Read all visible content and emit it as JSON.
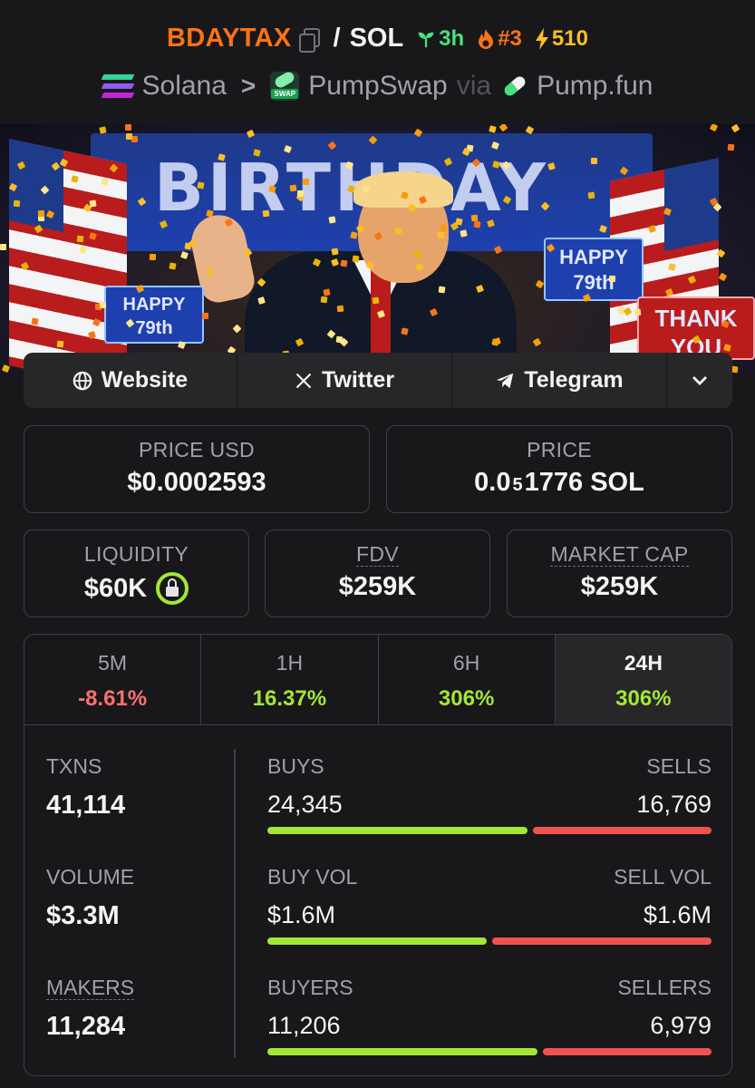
{
  "header": {
    "token_symbol": "BDAYTAX",
    "separator": "/",
    "quote_symbol": "SOL",
    "age": "3h",
    "rank": "#3",
    "boosts": "510",
    "chain": "Solana",
    "dex": "PumpSwap",
    "via": "via",
    "launchpad": "Pump.fun"
  },
  "links": {
    "website": "Website",
    "twitter": "Twitter",
    "telegram": "Telegram"
  },
  "banner": {
    "headline": "BIRTHDAY",
    "sign_left": "HAPPY 79th",
    "sign_right": "HAPPY 79th",
    "sign_thanks": "THANK YOU"
  },
  "price": {
    "usd_label": "PRICE USD",
    "usd_value": "$0.0002593",
    "native_label": "PRICE",
    "native_prefix": "0.0",
    "native_zeros": "5",
    "native_digits": "1776 SOL"
  },
  "metrics": {
    "liquidity_label": "LIQUIDITY",
    "liquidity_value": "$60K",
    "fdv_label": "FDV",
    "fdv_value": "$259K",
    "mcap_label": "MARKET CAP",
    "mcap_value": "$259K"
  },
  "timeframes": [
    {
      "label": "5M",
      "value": "-8.61%"
    },
    {
      "label": "1H",
      "value": "16.37%"
    },
    {
      "label": "6H",
      "value": "306%"
    },
    {
      "label": "24H",
      "value": "306%"
    }
  ],
  "activity": {
    "txns_label": "TXNS",
    "txns_value": "41,114",
    "volume_label": "VOLUME",
    "volume_value": "$3.3M",
    "makers_label": "MAKERS",
    "makers_value": "11,284",
    "buys_label": "BUYS",
    "buys_value": "24,345",
    "sells_label": "SELLS",
    "sells_value": "16,769",
    "buy_vol_label": "BUY VOL",
    "buy_vol_value": "$1.6M",
    "sell_vol_label": "SELL VOL",
    "sell_vol_value": "$1.6M",
    "buyers_label": "BUYERS",
    "buyers_value": "11,206",
    "sellers_label": "SELLERS",
    "sellers_value": "6,979",
    "buys_share": 0.592,
    "buy_vol_share": 0.5,
    "buyers_share": 0.616
  },
  "colors": {
    "accent_orange": "#f97316",
    "positive": "#a3e635",
    "negative": "#f87171",
    "age_green": "#4ade80",
    "boost_yellow": "#fbbf24"
  }
}
